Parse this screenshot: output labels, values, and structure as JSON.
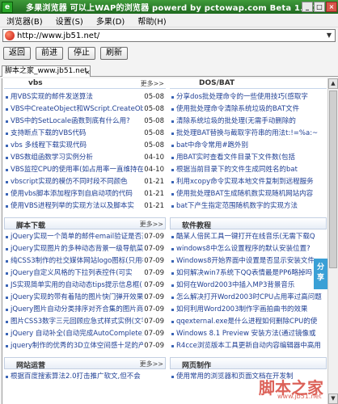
{
  "window": {
    "title": "多果浏览器    可以上WAP的浏览器    powerd by pctowap.com Beta 1.0.1",
    "icon_text": "e",
    "buttons": [
      "_",
      "□",
      "×"
    ]
  },
  "menu": [
    "浏览器(B)",
    "设置(S)",
    "多果(D)",
    "帮助(H)"
  ],
  "address": {
    "value": "http://www.jb51.net/",
    "dropdown": "▼"
  },
  "nav": {
    "back": "返回",
    "forward": "前进",
    "stop": "停止",
    "refresh": "刷新"
  },
  "tab": {
    "label": "脚本之家_www.jb51.net",
    "close": "×"
  },
  "sections": {
    "vbs": {
      "title": "vbs",
      "more": "更多>>",
      "items": [
        {
          "text": "用VBS实现的邮件发送算法",
          "date": "05-08"
        },
        {
          "text": "VBS中CreateObject和WScript.CreateObjec",
          "date": "05-08"
        },
        {
          "text": "VBS中的SetLocale函数到底有什么用?",
          "date": "05-08"
        },
        {
          "text": "支持断点下载的VBS代码",
          "date": "05-08"
        },
        {
          "text": "vbs 多线程下载实现代码",
          "date": "05-08"
        },
        {
          "text": "VBS数组函数学习实例分析",
          "date": "04-10"
        },
        {
          "text": "VBS监控CPU的使用率(如占用率一直维持在8",
          "date": "04-10"
        },
        {
          "text": "vbscript实现的模仿不同时段不同颜色",
          "date": "01-21"
        },
        {
          "text": "使用vbs脚本添加程序到自启动项的代码",
          "date": "01-21"
        },
        {
          "text": "使用VBS进程列举的实现方法以及脚本实",
          "date": "01-21"
        }
      ]
    },
    "dos": {
      "title": "DOS/BAT",
      "items": [
        "分享dos批处理命令的一些使用技巧(感取字",
        "使用批处理命令清除系统垃圾的BAT文件",
        "清除系统垃圾的批处理(无需手动删除的",
        "批处理BAT替换与截取字符串的用法t:!=%a:~",
        "bat中命令常用#跑外别",
        "用BAT实时查看文件目录下文件数(包括",
        "根据当前目录下的文件生成同姓名的bat",
        "利用xcopy命令实现本地文件复制到远程服务",
        "使用批处理BAT生成随机数实现随机网站内容",
        "bat下产生指定范围随机数字的实现方法"
      ]
    },
    "jiaoben": {
      "title": "脚本下载",
      "more": "更多>>",
      "items": [
        {
          "text": "jQuery实现一个简单的邮件email验证是否正",
          "date": "07-09"
        },
        {
          "text": "jQuery实现图片的多种动态背景一级导航菜单",
          "date": "07-09"
        },
        {
          "text": "纯CSS3制作的社交媒体网站logo图标(只用样",
          "date": "07-09"
        },
        {
          "text": "jQuery自定义风格的下拉列表控件(可实",
          "date": "07-09"
        },
        {
          "text": "JS实现简单实用的自动动态tips提示信息框(",
          "date": "07-09"
        },
        {
          "text": "jQuery实现的带有着陆的图片快门弹开效果实用",
          "date": "07-09"
        },
        {
          "text": "jQuery图片自动分类排序对齐合集的图片商",
          "date": "07-09"
        },
        {
          "text": "图片CSS3数字三元回顾应急式样式实例(文字的",
          "date": "07-09"
        },
        {
          "text": "jQuery 自动补全(自动完成AutoComplete)功能",
          "date": "07-09"
        },
        {
          "text": "jquery制作的优秀的3D立体空间感十足的产品",
          "date": "07-09"
        }
      ]
    },
    "ruanjian": {
      "title": "软件教程",
      "items": [
        "酷某人倍民工具一键打开在线音乐(无需下载Q",
        "windows8中怎么设置程序的默认安装位置?",
        "Windows8开始界面中设置是否显示安装文件",
        "如何解决win7系统下QQ表情最是PP6略掉吗",
        "如何在Word2003中插入MP3背景音乐",
        "怎么解决打开Word2003时CPU占用率过高问题",
        "如何利用Word2003制作字画拍曲书的效果",
        "qqexternal.exe是什么进程如何删除CPU的使",
        "Windows 8.1 Preview 安装方法(通过镜像或",
        "R4cce浏览版本工具更新自动内容编辑器中高用"
      ]
    },
    "wangzhan": {
      "title": "网站运营",
      "more": "更多>>",
      "items": [
        {
          "text": "根据百度搜索算法2.0打击推广软文,但不会",
          "date": ""
        }
      ]
    },
    "wangye": {
      "title": "网页制作",
      "items": [
        "使用常用的浏览器和页面文档在开发制"
      ]
    }
  },
  "share": "分享",
  "scrollbar": {
    "up": "▲",
    "down": "▼"
  },
  "watermark": {
    "main": "脚本之家",
    "sub": "www.jb51.net"
  }
}
